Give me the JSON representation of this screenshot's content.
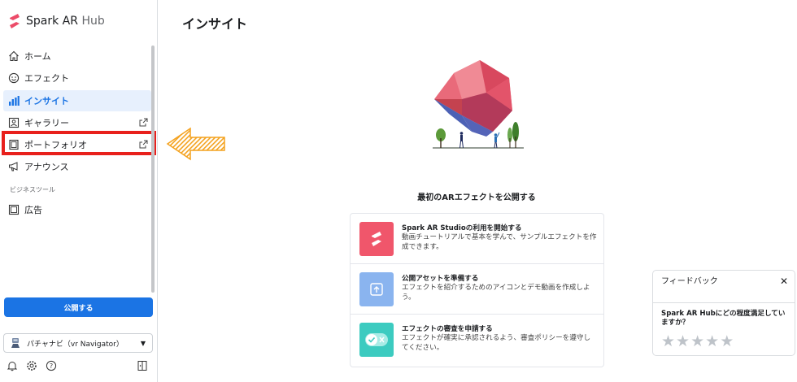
{
  "app": {
    "brand": "Spark AR",
    "brand_suffix": "Hub"
  },
  "sidebar": {
    "items": [
      {
        "label": "ホーム",
        "icon": "home-icon"
      },
      {
        "label": "エフェクト",
        "icon": "smiley-icon"
      },
      {
        "label": "インサイト",
        "icon": "bar-chart-icon",
        "active": true
      },
      {
        "label": "ギャラリー",
        "icon": "gallery-icon",
        "external": true
      },
      {
        "label": "ポートフォリオ",
        "icon": "portfolio-icon",
        "external": true
      },
      {
        "label": "アナウンス",
        "icon": "megaphone-icon"
      }
    ],
    "section_label": "ビジネスツール",
    "business_items": [
      {
        "label": "広告",
        "icon": "ad-icon"
      }
    ],
    "publish_label": "公開する",
    "account_name": "パチャナビ（vr Navigator）"
  },
  "main": {
    "title": "インサイト",
    "hero_heading": "最初のARエフェクトを公開する",
    "steps": [
      {
        "title": "Spark AR Studioの利用を開始する",
        "desc": "動画チュートリアルで基本を学んで、サンプルエフェクトを作成できます。",
        "icon": "spark-logo-icon"
      },
      {
        "title": "公開アセットを準備する",
        "desc": "エフェクトを紹介するためのアイコンとデモ動画を作成しよう。",
        "icon": "upload-icon"
      },
      {
        "title": "エフェクトの審査を申請する",
        "desc": "エフェクトが確実に承認されるよう、審査ポリシーを遵守してください。",
        "icon": "toggle-check-icon"
      }
    ]
  },
  "feedback": {
    "title": "フィードバック",
    "question": "Spark AR Hubにどの程度満足していますか？",
    "star_count": 5
  },
  "colors": {
    "accent": "#1b74e4",
    "highlight": "#e8201c",
    "arrow": "#f4a21f",
    "step1": "#f0566b",
    "step2": "#8ab4ef",
    "step3": "#3ccbc0"
  }
}
